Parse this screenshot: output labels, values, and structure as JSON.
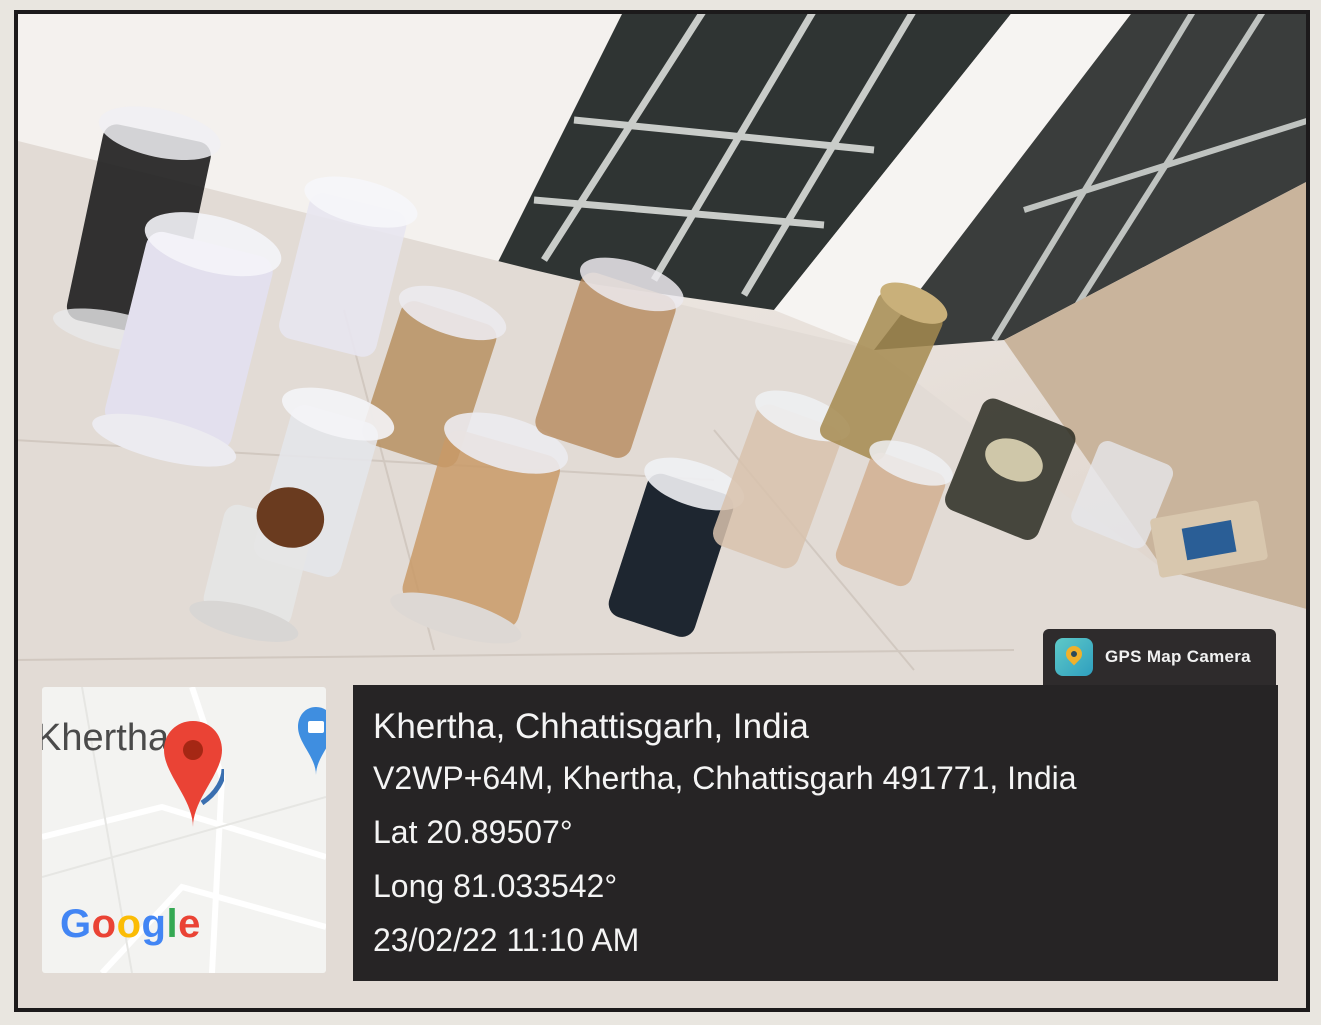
{
  "overlay": {
    "app_badge": "GPS Map Camera",
    "location_title": "Khertha, Chhattisgarh, India",
    "address": "V2WP+64M, Khertha, Chhattisgarh 491771, India",
    "latitude": "Lat 20.89507°",
    "longitude": "Long 81.033542°",
    "datetime": "23/02/22 11:10 AM"
  },
  "map": {
    "place_label": "Khertha",
    "logo_text": "Google"
  },
  "colors": {
    "panel_bg": "#121012",
    "panel_text": "#f4f4f4",
    "pin_red": "#ea4335",
    "poi_blue": "#3f8ee0"
  },
  "icons": {
    "badge": "gps-map-camera-icon",
    "map_pin": "map-pin-icon",
    "poi": "poi-marker-icon"
  }
}
